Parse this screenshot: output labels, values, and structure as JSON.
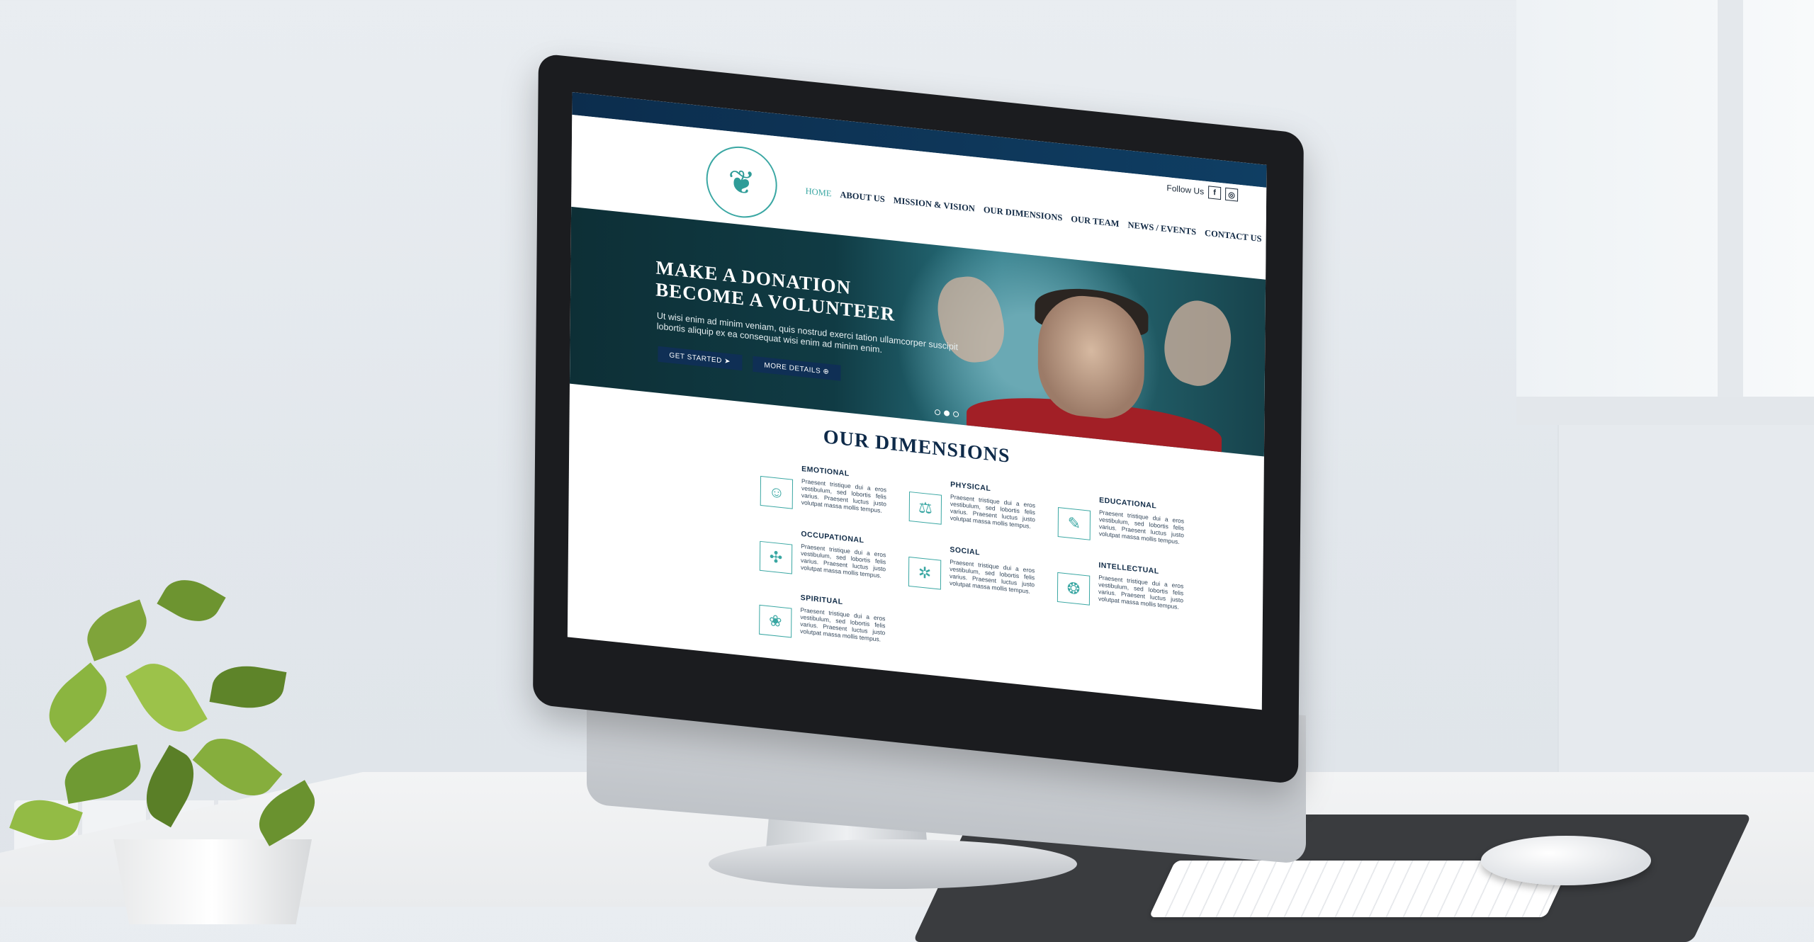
{
  "site": {
    "follow_label": "Follow Us",
    "social": [
      "f",
      "◎"
    ],
    "logo_icon": "tree-icon",
    "nav": [
      "HOME",
      "ABOUT US",
      "MISSION & VISION",
      "OUR DIMENSIONS",
      "OUR TEAM",
      "NEWS / EVENTS",
      "CONTACT US"
    ],
    "nav_icons": [
      "cart-icon",
      "search-icon"
    ]
  },
  "hero": {
    "title_line1": "MAKE A DONATION",
    "title_line2": "BECOME A VOLUNTEER",
    "text": "Ut wisi enim ad minim veniam, quis nostrud exerci tation ullamcorper suscipit lobortis aliquip ex ea consequat wisi enim ad minim enim.",
    "button1": "GET STARTED ➤",
    "button2": "MORE DETAILS ⊕",
    "slides": 3,
    "active_slide": 2
  },
  "dimensions": {
    "title": "OUR DIMENSIONS",
    "items": [
      {
        "label": "EMOTIONAL",
        "icon": "masks-icon",
        "text": "Praesent tristique dui a eros vestibulum, sed lobortis felis varius. Praesent luctus justo volutpat massa mollis tempus."
      },
      {
        "label": "PHYSICAL",
        "icon": "dumbbell-icon",
        "text": "Praesent tristique dui a eros vestibulum, sed lobortis felis varius. Praesent luctus justo volutpat massa mollis tempus."
      },
      {
        "label": "EDUCATIONAL",
        "icon": "book-icon",
        "text": "Praesent tristique dui a eros vestibulum, sed lobortis felis varius. Praesent luctus justo volutpat massa mollis tempus."
      },
      {
        "label": "OCCUPATIONAL",
        "icon": "network-icon",
        "text": "Praesent tristique dui a eros vestibulum, sed lobortis felis varius. Praesent luctus justo volutpat massa mollis tempus."
      },
      {
        "label": "SOCIAL",
        "icon": "people-icon",
        "text": "Praesent tristique dui a eros vestibulum, sed lobortis felis varius. Praesent luctus justo volutpat massa mollis tempus."
      },
      {
        "label": "INTELLECTUAL",
        "icon": "brain-icon",
        "text": "Praesent tristique dui a eros vestibulum, sed lobortis felis varius. Praesent luctus justo volutpat massa mollis tempus."
      },
      {
        "label": "SPIRITUAL",
        "icon": "lotus-icon",
        "text": "Praesent tristique dui a eros vestibulum, sed lobortis felis varius. Praesent luctus justo volutpat massa mollis tempus."
      }
    ]
  },
  "colors": {
    "teal": "#3aa7a3",
    "navy": "#0e2a49"
  }
}
